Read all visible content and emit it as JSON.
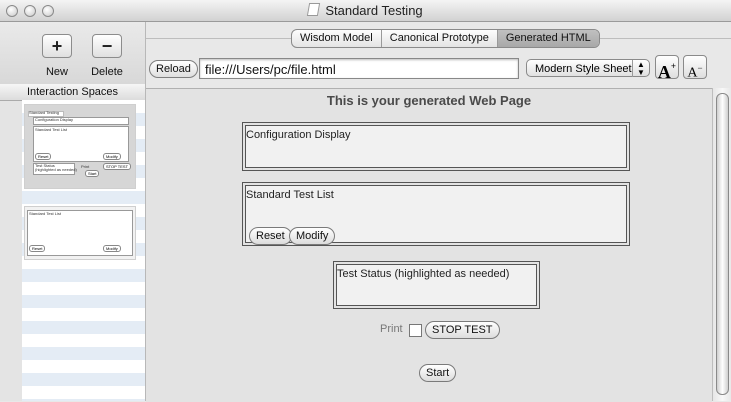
{
  "window": {
    "title": "Standard Testing"
  },
  "toolbar": {
    "new_label": "New",
    "delete_label": "Delete",
    "new_symbol": "+",
    "delete_symbol": "−"
  },
  "sidebar": {
    "header": "Interaction Spaces",
    "thumb1": {
      "tab": "Standard Testing",
      "config": "Configuration Display",
      "list": "Standard Test List",
      "reset": "Reset",
      "modify": "Modify",
      "status": "Test Status",
      "status_sub": "(highlighted as needed)",
      "print": "Print",
      "stop": "STOP TEST",
      "start": "Start"
    },
    "thumb2": {
      "list": "Standard Test List",
      "reset": "Reset",
      "modify": "Modify"
    }
  },
  "tabs": [
    {
      "label": "Wisdom Model",
      "active": false
    },
    {
      "label": "Canonical Prototype",
      "active": false
    },
    {
      "label": "Generated HTML",
      "active": true
    }
  ],
  "navbar": {
    "reload_label": "Reload",
    "url_value": "file:///Users/pc/file.html",
    "stylesheet_selected": "Modern Style Sheet",
    "font_larger": "A",
    "font_larger_sup": "+",
    "font_smaller": "A",
    "font_smaller_sup": "−"
  },
  "webpage": {
    "heading": "This is your generated Web Page",
    "config_display": "Configuration Display",
    "test_list": "Standard Test List",
    "reset_label": "Reset",
    "modify_label": "Modify",
    "test_status": "Test Status (highlighted as needed)",
    "print_label": "Print",
    "print_checked": false,
    "stop_label": "STOP TEST",
    "start_label": "Start"
  },
  "icons": {
    "window_close": "traffic-light-icon",
    "document": "document-icon",
    "popup_arrows": "updown-arrows-icon"
  }
}
